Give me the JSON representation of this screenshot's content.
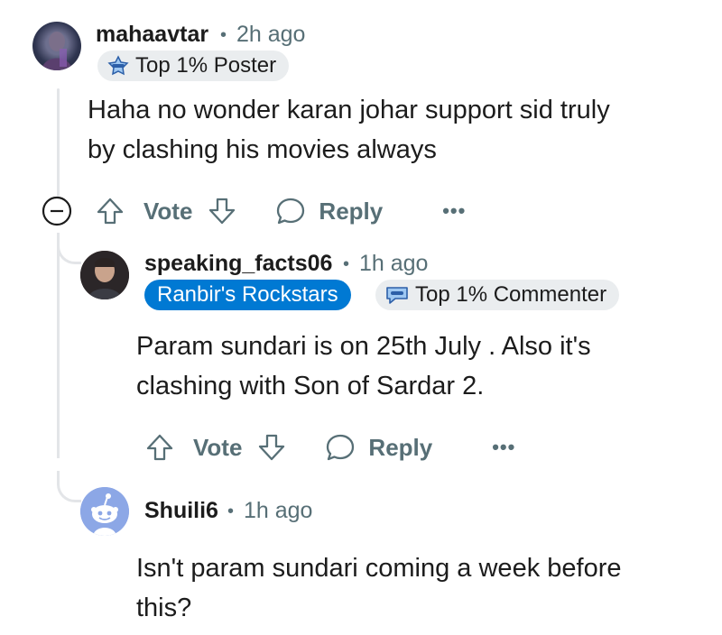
{
  "comments": [
    {
      "username": "mahaavtar",
      "separator": "•",
      "time": "2h ago",
      "badge": "Top 1% Poster",
      "body_line1": "Haha no wonder karan johar support sid truly",
      "body_line2": "by clashing his movies always",
      "vote_label": "Vote",
      "reply_label": "Reply",
      "more_label": "•••"
    },
    {
      "username": "speaking_facts06",
      "separator": "•",
      "time": "1h ago",
      "flair": "Ranbir's Rockstars",
      "badge": "Top 1% Commenter",
      "body_line1": "Param sundari is on 25th July . Also it's",
      "body_line2": "clashing with Son of Sardar 2.",
      "vote_label": "Vote",
      "reply_label": "Reply",
      "more_label": "•••"
    },
    {
      "username": "Shuili6",
      "separator": "•",
      "time": "1h ago",
      "body_line1": "Isn't param sundari coming a week before",
      "body_line2": "this?"
    }
  ],
  "colors": {
    "flair_bg": "#0079d3",
    "badge_bg": "#eaedef",
    "meta_text": "#576f76",
    "thread_line": "#e3e5e8",
    "default_avatar": "#8ca7e6"
  },
  "icons": [
    "collapse-thread-icon",
    "upvote-icon",
    "downvote-icon",
    "reply-bubble-icon",
    "more-dots-icon",
    "poster-badge-icon",
    "commenter-badge-icon",
    "snoo-avatar-icon"
  ]
}
